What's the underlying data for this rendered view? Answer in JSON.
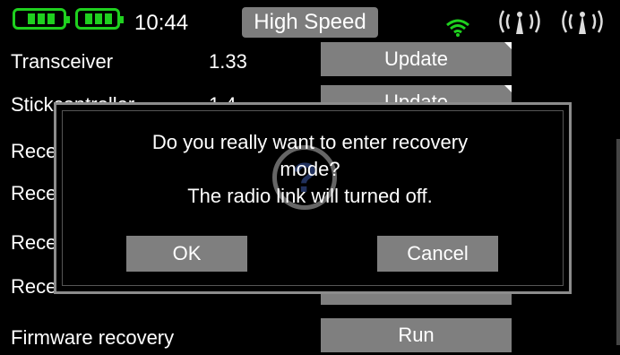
{
  "status_bar": {
    "time": "10:44",
    "mode": "High Speed",
    "battery_color": "#1fd11f",
    "wifi_color": "#1fd11f",
    "icons": [
      "battery-icon",
      "battery-icon",
      "wifi-icon",
      "antenna-icon",
      "antenna-icon"
    ]
  },
  "rows": [
    {
      "label": "Transceiver",
      "version": "1.33",
      "button": "Update"
    },
    {
      "label": "Stickcontroller",
      "version": "1.4",
      "button": "Update"
    },
    {
      "label": "Rece",
      "version": "",
      "button": ""
    },
    {
      "label": "Rece",
      "version": "",
      "button": ""
    },
    {
      "label": "Rece",
      "version": "",
      "button": ""
    },
    {
      "label": "Rece",
      "version": "",
      "button": ""
    },
    {
      "label": "Firmware recovery",
      "version": "",
      "button": "Run"
    }
  ],
  "dialog": {
    "line1": "Do you really want to enter recovery",
    "line2": "mode?",
    "line3": "The radio link will turned off.",
    "ok_label": "OK",
    "cancel_label": "Cancel",
    "icon": "question-icon",
    "icon_glyph": "?"
  }
}
